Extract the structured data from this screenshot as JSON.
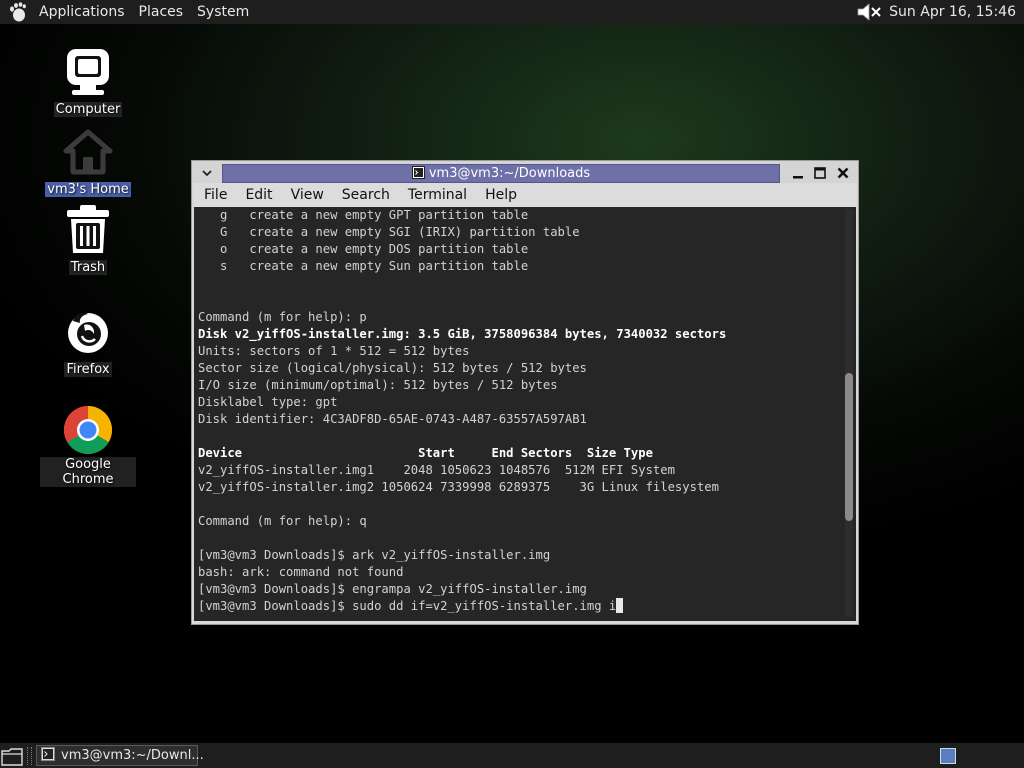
{
  "top_panel": {
    "menus": [
      "Applications",
      "Places",
      "System"
    ],
    "clock": "Sun Apr 16, 15:46"
  },
  "desktop_icons": [
    {
      "label": "Computer",
      "icon": "computer-icon"
    },
    {
      "label": "vm3's Home",
      "icon": "home-folder-icon"
    },
    {
      "label": "Trash",
      "icon": "trash-icon"
    },
    {
      "label": "Firefox",
      "icon": "firefox-icon"
    },
    {
      "label": "Google Chrome",
      "icon": "chrome-icon"
    }
  ],
  "window": {
    "title": "vm3@vm3:~/Downloads",
    "menus": [
      "File",
      "Edit",
      "View",
      "Search",
      "Terminal",
      "Help"
    ]
  },
  "terminal": {
    "lines": [
      {
        "text": "   g   create a new empty GPT partition table",
        "bold": false
      },
      {
        "text": "   G   create a new empty SGI (IRIX) partition table",
        "bold": false
      },
      {
        "text": "   o   create a new empty DOS partition table",
        "bold": false
      },
      {
        "text": "   s   create a new empty Sun partition table",
        "bold": false
      },
      {
        "text": "",
        "bold": false
      },
      {
        "text": "",
        "bold": false
      },
      {
        "text": "Command (m for help): p",
        "bold": false
      },
      {
        "text": "Disk v2_yiffOS-installer.img: 3.5 GiB, 3758096384 bytes, 7340032 sectors",
        "bold": true
      },
      {
        "text": "Units: sectors of 1 * 512 = 512 bytes",
        "bold": false
      },
      {
        "text": "Sector size (logical/physical): 512 bytes / 512 bytes",
        "bold": false
      },
      {
        "text": "I/O size (minimum/optimal): 512 bytes / 512 bytes",
        "bold": false
      },
      {
        "text": "Disklabel type: gpt",
        "bold": false
      },
      {
        "text": "Disk identifier: 4C3ADF8D-65AE-0743-A487-63557A597AB1",
        "bold": false
      },
      {
        "text": "",
        "bold": false
      },
      {
        "text": "Device                        Start     End Sectors  Size Type",
        "bold": true
      },
      {
        "text": "v2_yiffOS-installer.img1    2048 1050623 1048576  512M EFI System",
        "bold": false
      },
      {
        "text": "v2_yiffOS-installer.img2 1050624 7339998 6289375    3G Linux filesystem",
        "bold": false
      },
      {
        "text": "",
        "bold": false
      },
      {
        "text": "Command (m for help): q",
        "bold": false
      },
      {
        "text": "",
        "bold": false
      },
      {
        "text": "[vm3@vm3 Downloads]$ ark v2_yiffOS-installer.img",
        "bold": false
      },
      {
        "text": "bash: ark: command not found",
        "bold": false
      },
      {
        "text": "[vm3@vm3 Downloads]$ engrampa v2_yiffOS-installer.img",
        "bold": false
      },
      {
        "text": "[vm3@vm3 Downloads]$ sudo dd if=v2_yiffOS-installer.img i",
        "bold": false,
        "cursor": true
      }
    ],
    "scroll_position": 0.63
  },
  "taskbar": {
    "task_label": "vm3@vm3:~/Downl..."
  },
  "colors": {
    "title_active": "#6f70a8",
    "terminal_bg": "#262626",
    "panel_bg": "#1e1e1e"
  }
}
